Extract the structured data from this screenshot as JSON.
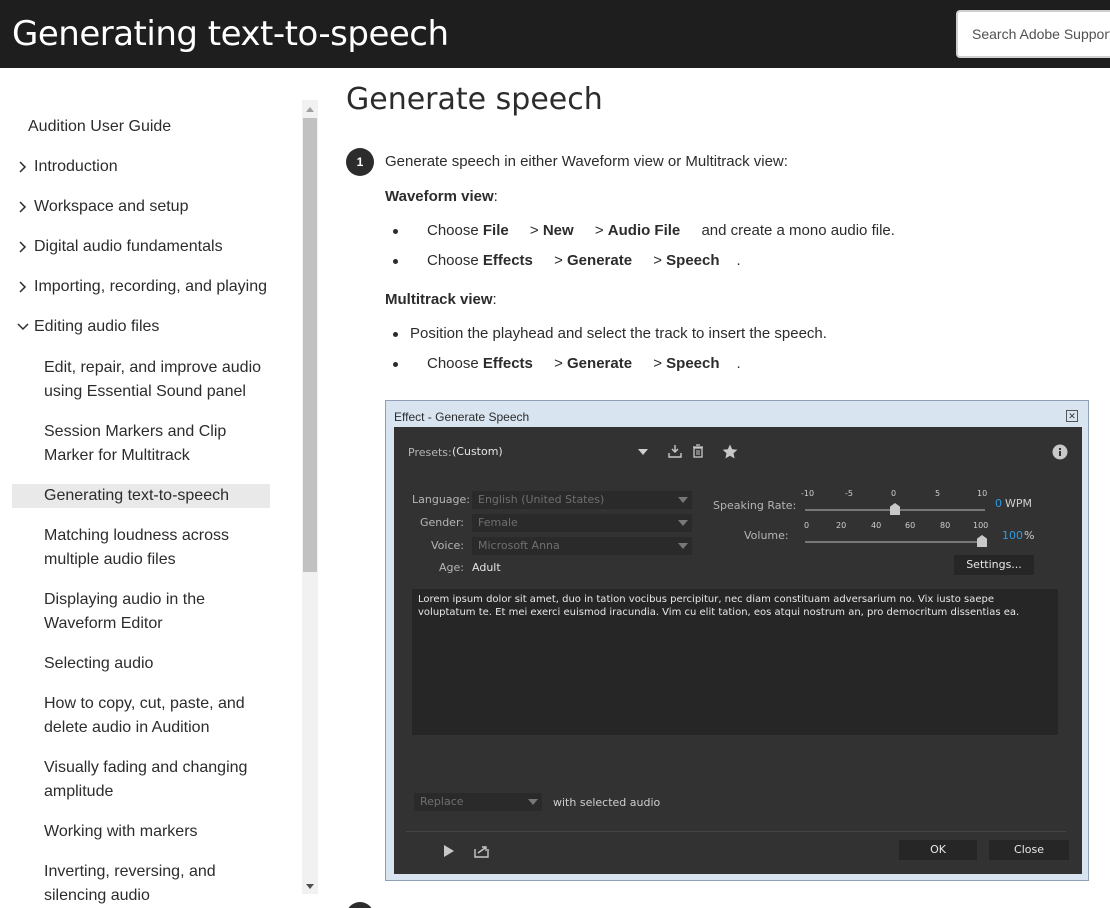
{
  "header": {
    "title": "Generating text-to-speech",
    "search_placeholder": "Search Adobe Support"
  },
  "sidebar": {
    "root": "Audition User Guide",
    "sections": [
      {
        "label": "Introduction",
        "expanded": false
      },
      {
        "label": "Workspace and setup",
        "expanded": false
      },
      {
        "label": "Digital audio fundamentals",
        "expanded": false
      },
      {
        "label": "Importing, recording, and playing",
        "expanded": false
      },
      {
        "label": "Editing audio files",
        "expanded": true
      }
    ],
    "items": [
      "Edit, repair, and improve audio using Essential Sound panel",
      "Session Markers and Clip Marker for Multitrack",
      "Generating text-to-speech",
      "Matching loudness across multiple audio files",
      "Displaying audio in the Waveform Editor",
      "Selecting audio",
      "How to copy, cut, paste, and delete audio in Audition",
      "Visually fading and changing amplitude",
      "Working with markers",
      "Inverting, reversing, and silencing audio"
    ],
    "active_item": "Generating text-to-speech"
  },
  "main": {
    "title": "Generate speech",
    "step1": {
      "number": "1",
      "text": "Generate speech in either Waveform view or Multitrack view:",
      "waveform_heading": "Waveform view",
      "waveform_bullets": [
        {
          "pre": "Choose ",
          "b1": "File",
          "s1": " > ",
          "b2": "New",
          "s2": " > ",
          "b3": "Audio File",
          "post": " and create a mono audio file."
        },
        {
          "pre": "Choose ",
          "b1": "Effects",
          "s1": " > ",
          "b2": "Generate",
          "s2": " > ",
          "b3": "Speech",
          "post": "."
        }
      ],
      "multitrack_heading": "Multitrack view",
      "multitrack_bullets": [
        {
          "text": "Position the playhead and select the track to insert the speech."
        },
        {
          "pre": "Choose ",
          "b1": "Effects",
          "s1": " > ",
          "b2": "Generate",
          "s2": " > ",
          "b3": "Speech",
          "post": "."
        }
      ]
    }
  },
  "dialog": {
    "title": "Effect - Generate Speech",
    "presets_label": "Presets:",
    "preset_value": "(Custom)",
    "language_label": "Language:",
    "language_value": "English (United States)",
    "gender_label": "Gender:",
    "gender_value": "Female",
    "voice_label": "Voice:",
    "voice_value": "Microsoft Anna",
    "age_label": "Age:",
    "age_value": "Adult",
    "speaking_rate_label": "Speaking Rate:",
    "speaking_rate_ticks": [
      "-10",
      "-5",
      "0",
      "5",
      "10"
    ],
    "speaking_rate_value": "0",
    "speaking_rate_unit": "WPM",
    "volume_label": "Volume:",
    "volume_ticks": [
      "0",
      "20",
      "40",
      "60",
      "80",
      "100"
    ],
    "volume_value": "100",
    "volume_unit": "%",
    "settings_button": "Settings...",
    "text": "Lorem ipsum dolor sit amet, duo in tation vocibus percipitur, nec diam constituam adversarium no. Vix iusto saepe voluptatum te. Et mei exerci euismod iracundia. Vim cu elit tation, eos atqui nostrum an, pro democritum dissentias ea.",
    "mode_value": "Replace",
    "mode_suffix": "with selected audio",
    "ok_button": "OK",
    "close_button": "Close",
    "accent_color": "#2d9ce4"
  }
}
